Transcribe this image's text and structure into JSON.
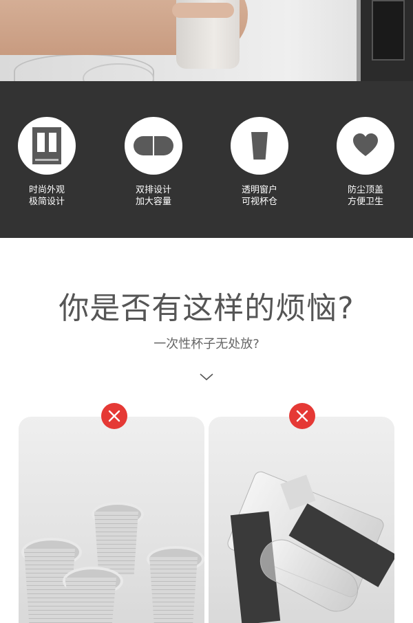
{
  "features": [
    {
      "line1": "时尚外观",
      "line2": "极简设计",
      "icon": "dispenser-icon"
    },
    {
      "line1": "双排设计",
      "line2": "加大容量",
      "icon": "double-row-icon"
    },
    {
      "line1": "透明窗户",
      "line2": "可视杯仓",
      "icon": "cup-icon"
    },
    {
      "line1": "防尘顶盖",
      "line2": "方便卫生",
      "icon": "heart-icon"
    }
  ],
  "headline": "你是否有这样的烦恼?",
  "subline": "一次性杯子无处放?",
  "colors": {
    "band": "#333333",
    "icon_gray": "#5a5a5a",
    "warning_red": "#e53935",
    "headline": "#555555"
  }
}
